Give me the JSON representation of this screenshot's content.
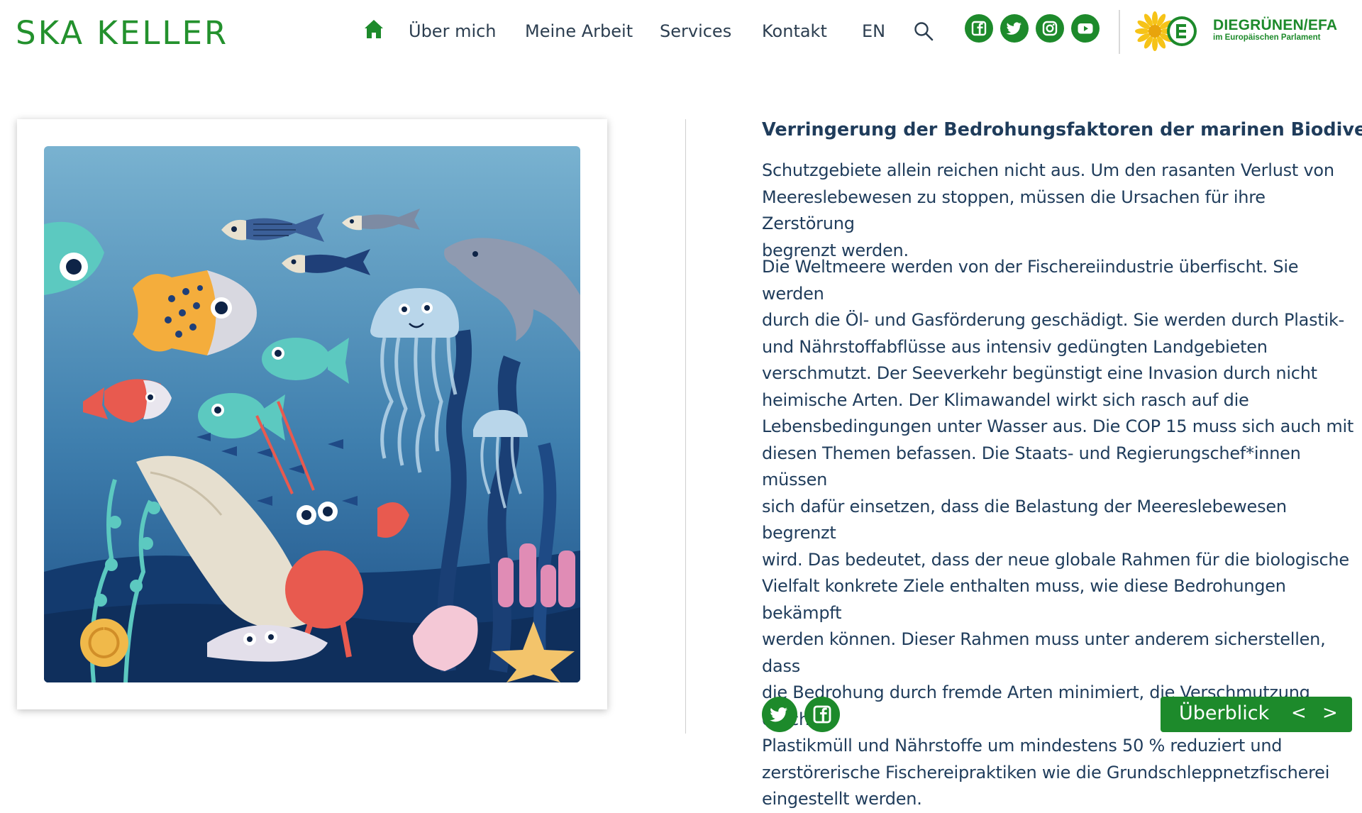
{
  "header": {
    "logo": "SKA KELLER",
    "nav": {
      "home_icon": "home-icon",
      "items": [
        "Über mich",
        "Meine Arbeit",
        "Services",
        "Kontakt"
      ],
      "language": "EN",
      "search_icon": "search-icon"
    },
    "social": [
      "facebook-icon",
      "twitter-icon",
      "instagram-icon",
      "youtube-icon"
    ],
    "partner_logo": {
      "title": "DIEGRÜNEN/EFA",
      "subtitle": "im Europäischen Parlament"
    }
  },
  "illustration": {
    "description_icon": "ocean-illustration"
  },
  "article": {
    "heading": "Verringerung der Bedrohungsfaktoren der marinen Biodiversität",
    "paragraph1_lines": [
      "Schutzgebiete allein reichen nicht aus. Um den rasanten Verlust von",
      "Meereslebewesen zu stoppen, müssen die Ursachen für ihre Zerstörung",
      "begrenzt werden."
    ],
    "paragraph2_lines": [
      "Die Weltmeere werden von der Fischereiindustrie überfischt. Sie werden",
      "durch die Öl- und Gasförderung geschädigt. Sie werden durch Plastik-",
      "und Nährstoffabflüsse aus intensiv gedüngten Landgebieten",
      "verschmutzt. Der Seeverkehr begünstigt eine Invasion durch nicht",
      "heimische Arten. Der Klimawandel wirkt sich rasch auf die",
      "Lebensbedingungen unter Wasser aus. Die COP 15 muss sich auch mit",
      "diesen Themen befassen. Die Staats- und Regierungschef*innen müssen",
      "sich dafür einsetzen, dass die Belastung der Meereslebewesen begrenzt",
      "wird. Das bedeutet, dass der neue globale Rahmen für die biologische",
      "Vielfalt konkrete Ziele enthalten muss, wie diese Bedrohungen bekämpft",
      "werden können. Dieser Rahmen muss unter anderem sicherstellen, dass",
      "die Bedrohung durch fremde Arten minimiert, die Verschmutzung durch",
      "Plastikmüll und Nährstoffe um mindestens 50 % reduziert und",
      "zerstörerische Fischereipraktiken wie die Grundschleppnetzfischerei",
      "eingestellt werden."
    ]
  },
  "footer_actions": {
    "share": [
      "twitter-icon",
      "facebook-icon"
    ],
    "overview_label": "Überblick",
    "prev": "<",
    "next": ">"
  },
  "colors": {
    "brand_green": "#1d8a2b",
    "logo_green": "#23912d",
    "text_navy": "#1f3c5b"
  }
}
